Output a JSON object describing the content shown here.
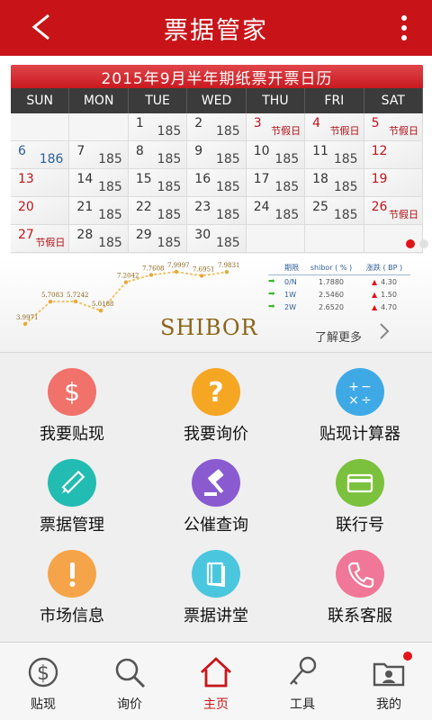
{
  "header": {
    "title": "票据管家"
  },
  "calendar": {
    "banner": "2015年9月半年期纸票开票日历",
    "weekdays": [
      "SUN",
      "MON",
      "TUE",
      "WED",
      "THU",
      "FRI",
      "SAT"
    ],
    "cells": [
      {
        "day": "",
        "value": "",
        "holiday": ""
      },
      {
        "day": "",
        "value": "",
        "holiday": ""
      },
      {
        "day": "1",
        "value": "185",
        "holiday": ""
      },
      {
        "day": "2",
        "value": "185",
        "holiday": ""
      },
      {
        "day": "3",
        "value": "",
        "holiday": "节假日"
      },
      {
        "day": "4",
        "value": "",
        "holiday": "节假日"
      },
      {
        "day": "5",
        "value": "",
        "holiday": "节假日"
      },
      {
        "day": "6",
        "value": "186",
        "holiday": ""
      },
      {
        "day": "7",
        "value": "185",
        "holiday": ""
      },
      {
        "day": "8",
        "value": "185",
        "holiday": ""
      },
      {
        "day": "9",
        "value": "185",
        "holiday": ""
      },
      {
        "day": "10",
        "value": "185",
        "holiday": ""
      },
      {
        "day": "11",
        "value": "185",
        "holiday": ""
      },
      {
        "day": "12",
        "value": "",
        "holiday": ""
      },
      {
        "day": "13",
        "value": "",
        "holiday": ""
      },
      {
        "day": "14",
        "value": "185",
        "holiday": ""
      },
      {
        "day": "15",
        "value": "185",
        "holiday": ""
      },
      {
        "day": "16",
        "value": "185",
        "holiday": ""
      },
      {
        "day": "17",
        "value": "185",
        "holiday": ""
      },
      {
        "day": "18",
        "value": "185",
        "holiday": ""
      },
      {
        "day": "19",
        "value": "",
        "holiday": ""
      },
      {
        "day": "20",
        "value": "",
        "holiday": ""
      },
      {
        "day": "21",
        "value": "185",
        "holiday": ""
      },
      {
        "day": "22",
        "value": "185",
        "holiday": ""
      },
      {
        "day": "23",
        "value": "185",
        "holiday": ""
      },
      {
        "day": "24",
        "value": "185",
        "holiday": ""
      },
      {
        "day": "25",
        "value": "185",
        "holiday": ""
      },
      {
        "day": "26",
        "value": "",
        "holiday": "节假日"
      },
      {
        "day": "27",
        "value": "",
        "holiday": "节假日"
      },
      {
        "day": "28",
        "value": "185",
        "holiday": ""
      },
      {
        "day": "29",
        "value": "185",
        "holiday": ""
      },
      {
        "day": "30",
        "value": "185",
        "holiday": ""
      },
      {
        "day": "",
        "value": "",
        "holiday": ""
      },
      {
        "day": "",
        "value": "",
        "holiday": ""
      },
      {
        "day": "",
        "value": "",
        "holiday": ""
      }
    ],
    "page_count": 2,
    "page_active": 0
  },
  "shibor": {
    "word": "SHIBOR",
    "chart_points": [
      "3.9971",
      "5.7083",
      "5.7242",
      "5.0188",
      "7.2042",
      "7.7608",
      "7.9997",
      "7.6951",
      "7.9831"
    ],
    "table": {
      "headers": [
        "期限",
        "shibor ( % )",
        "涨跌 ( BP )"
      ],
      "rows": [
        {
          "term": "0/N",
          "rate": "1.7880",
          "change": "4.30"
        },
        {
          "term": "1W",
          "rate": "2.5460",
          "change": "1.50"
        },
        {
          "term": "2W",
          "rate": "2.6520",
          "change": "4.70"
        }
      ]
    },
    "more": "了解更多"
  },
  "features": [
    {
      "label": "我要贴现",
      "icon": "dollar-icon",
      "color": "#f0726a"
    },
    {
      "label": "我要询价",
      "icon": "question-icon",
      "color": "#f5a623"
    },
    {
      "label": "贴现计算器",
      "icon": "calculator-icon",
      "color": "#3fa9e6"
    },
    {
      "label": "票据管理",
      "icon": "pencil-icon",
      "color": "#23bcb2"
    },
    {
      "label": "公催查询",
      "icon": "gavel-icon",
      "color": "#8a5bd0"
    },
    {
      "label": "联行号",
      "icon": "card-icon",
      "color": "#7bc13d"
    },
    {
      "label": "市场信息",
      "icon": "exclamation-icon",
      "color": "#f6a44a"
    },
    {
      "label": "票据讲堂",
      "icon": "book-icon",
      "color": "#4ac7de"
    },
    {
      "label": "联系客服",
      "icon": "phone-icon",
      "color": "#f07797"
    }
  ],
  "tabs": [
    {
      "label": "贴现",
      "icon": "dollar-coin-icon"
    },
    {
      "label": "询价",
      "icon": "magnifier-icon"
    },
    {
      "label": "主页",
      "icon": "home-icon"
    },
    {
      "label": "工具",
      "icon": "key-icon"
    },
    {
      "label": "我的",
      "icon": "profile-folder-icon"
    }
  ],
  "colors": {
    "brand": "#c81418",
    "holiday": "#b01218",
    "gold": "#8a6418"
  }
}
